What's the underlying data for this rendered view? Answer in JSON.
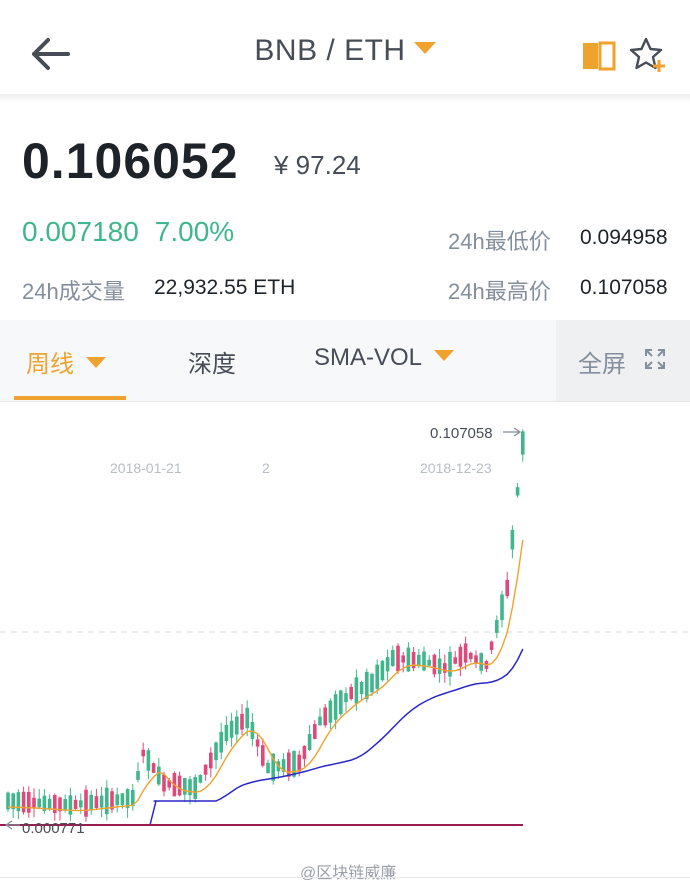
{
  "header": {
    "pair": "BNB / ETH",
    "back_icon": "back-arrow-icon",
    "book_icon": "book-icon",
    "favorite_icon": "star-plus-icon"
  },
  "ticker": {
    "last_price": "0.106052",
    "cny_price": "¥ 97.24",
    "change": "0.007180",
    "change_percent": "7.00%",
    "volume_label": "24h成交量",
    "volume_value": "22,932.55 ETH",
    "low_label": "24h最低价",
    "low_value": "0.094958",
    "high_label": "24h最高价",
    "high_value": "0.107058"
  },
  "tabs": {
    "period": "周线",
    "depth": "深度",
    "indicator": "SMA-VOL",
    "fullscreen": "全屏"
  },
  "chart_data": {
    "type": "candlestick",
    "max_label": "0.107058",
    "min_label": "0.000771",
    "x_ticks": [
      "2018-01-21",
      "2",
      "2018-12-23"
    ],
    "watermark": "@区块链威廉",
    "colors": {
      "up": "#3fb68b",
      "down": "#e0487a",
      "ma_short": "#f0a22e",
      "ma_long": "#2a27c9",
      "base": "#9b1d4f"
    }
  }
}
